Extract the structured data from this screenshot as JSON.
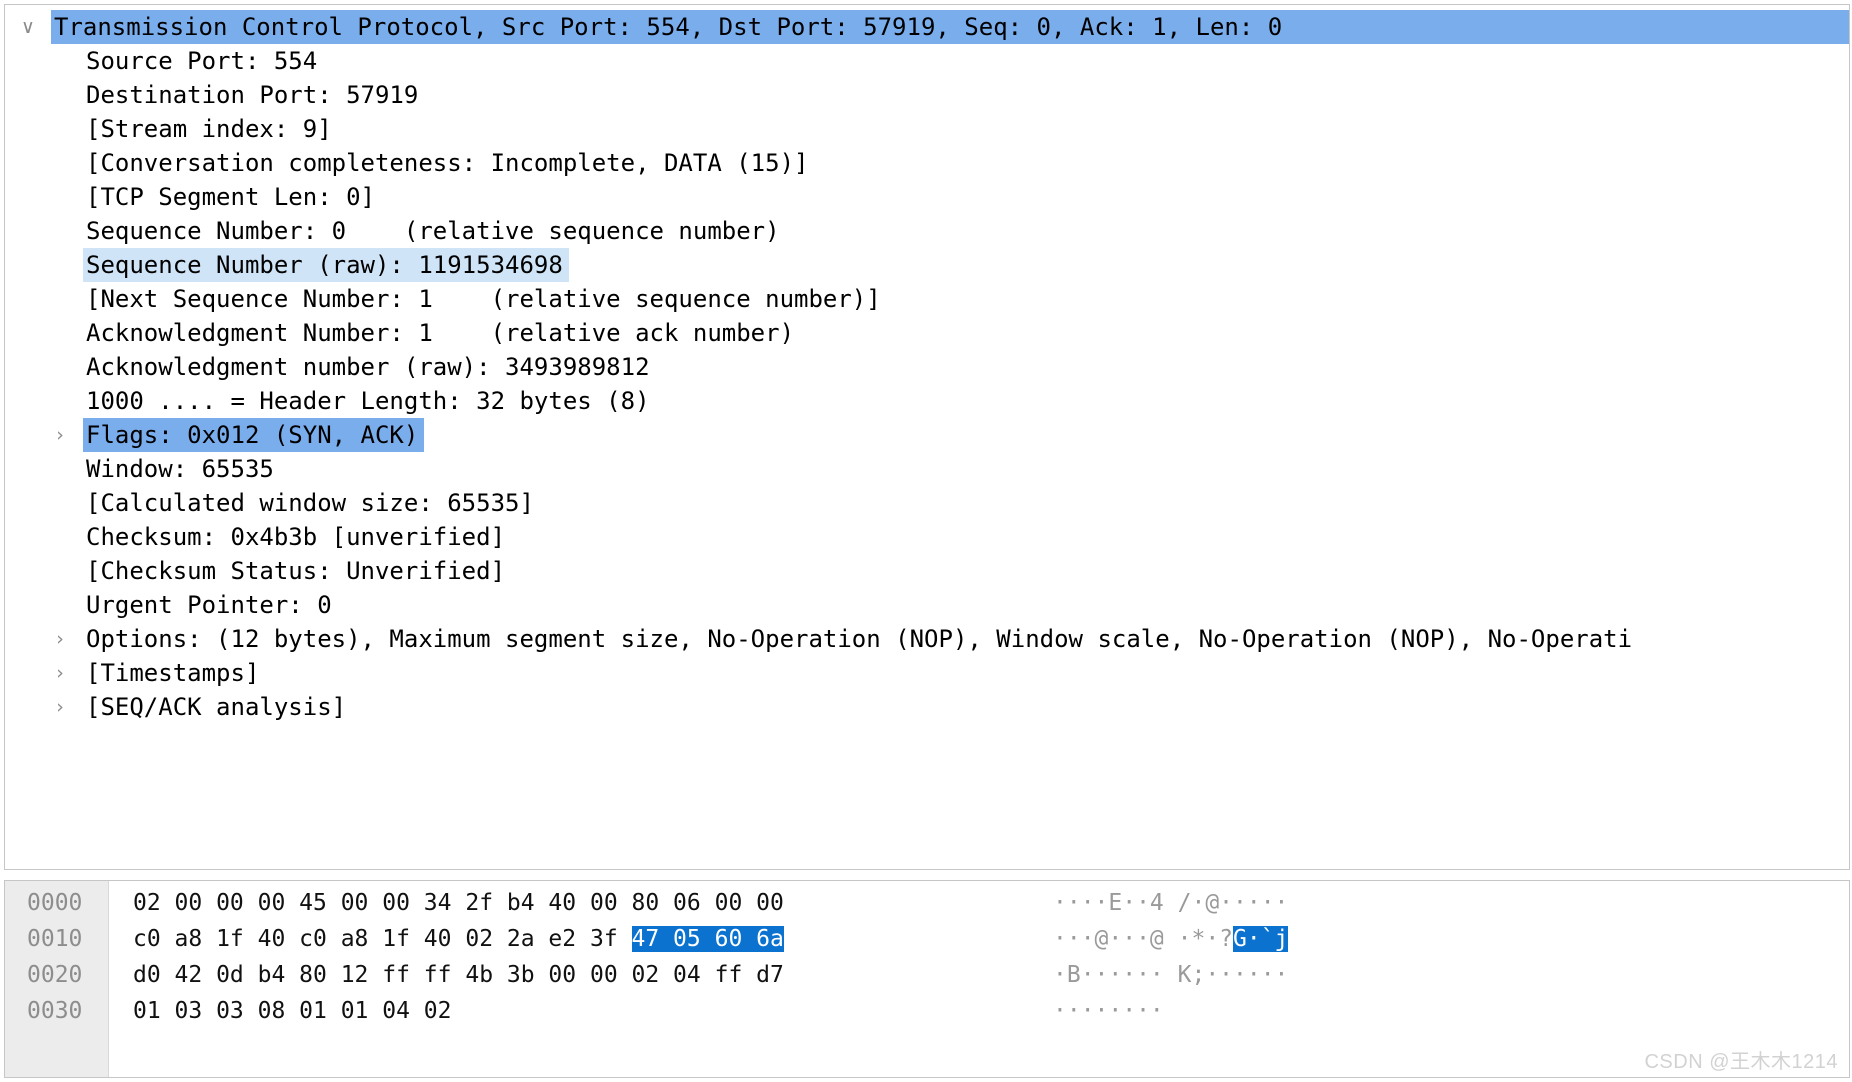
{
  "app": {
    "name": "Wireshark packet detail",
    "watermark": "CSDN @王木木1214"
  },
  "detail_pane": {
    "name": "packet-details",
    "rows": [
      {
        "text": "Transmission Control Protocol, Src Port: 554, Dst Port: 57919, Seq: 0, Ack: 1, Len: 0",
        "level": 0,
        "twisty": "∨",
        "state": "selected",
        "full_width": true
      },
      {
        "text": "Source Port: 554",
        "level": 1,
        "twisty": "",
        "state": "normal"
      },
      {
        "text": "Destination Port: 57919",
        "level": 1,
        "twisty": "",
        "state": "normal"
      },
      {
        "text": "[Stream index: 9]",
        "level": 1,
        "twisty": "",
        "state": "normal"
      },
      {
        "text": "[Conversation completeness: Incomplete, DATA (15)]",
        "level": 1,
        "twisty": "",
        "state": "normal"
      },
      {
        "text": "[TCP Segment Len: 0]",
        "level": 1,
        "twisty": "",
        "state": "normal"
      },
      {
        "text": "Sequence Number: 0    (relative sequence number)",
        "level": 1,
        "twisty": "",
        "state": "normal"
      },
      {
        "text": "Sequence Number (raw): 1191534698",
        "level": 1,
        "twisty": "",
        "state": "highlight"
      },
      {
        "text": "[Next Sequence Number: 1    (relative sequence number)]",
        "level": 1,
        "twisty": "",
        "state": "normal"
      },
      {
        "text": "Acknowledgment Number: 1    (relative ack number)",
        "level": 1,
        "twisty": "",
        "state": "normal"
      },
      {
        "text": "Acknowledgment number (raw): 3493989812",
        "level": 1,
        "twisty": "",
        "state": "normal"
      },
      {
        "text": "1000 .... = Header Length: 32 bytes (8)",
        "level": 1,
        "twisty": "",
        "state": "normal"
      },
      {
        "text": "Flags: 0x012 (SYN, ACK)",
        "level": 1,
        "twisty": "›",
        "state": "selected"
      },
      {
        "text": "Window: 65535",
        "level": 1,
        "twisty": "",
        "state": "normal"
      },
      {
        "text": "[Calculated window size: 65535]",
        "level": 1,
        "twisty": "",
        "state": "normal"
      },
      {
        "text": "Checksum: 0x4b3b [unverified]",
        "level": 1,
        "twisty": "",
        "state": "normal"
      },
      {
        "text": "[Checksum Status: Unverified]",
        "level": 1,
        "twisty": "",
        "state": "normal"
      },
      {
        "text": "Urgent Pointer: 0",
        "level": 1,
        "twisty": "",
        "state": "normal"
      },
      {
        "text": "Options: (12 bytes), Maximum segment size, No-Operation (NOP), Window scale, No-Operation (NOP), No-Operati",
        "level": 1,
        "twisty": "›",
        "state": "normal"
      },
      {
        "text": "[Timestamps]",
        "level": 1,
        "twisty": "›",
        "state": "normal"
      },
      {
        "text": "[SEQ/ACK analysis]",
        "level": 1,
        "twisty": "›",
        "state": "normal"
      }
    ]
  },
  "bytes_pane": {
    "name": "packet-bytes",
    "rows": [
      {
        "offset": "0000",
        "hex_groups": [
          {
            "text": "02 00 00 00 45 00 00 34 ",
            "highlight": false
          },
          {
            "text": "2f b4 40 00 80 06 00 00",
            "highlight": false
          }
        ],
        "ascii_groups": [
          {
            "text": "····E··4 ",
            "highlight": false,
            "dim": true
          },
          {
            "text": "/·@·····",
            "highlight": false,
            "dim": true
          }
        ]
      },
      {
        "offset": "0010",
        "hex_groups": [
          {
            "text": "c0 a8 1f 40 c0 a8 1f 40 ",
            "highlight": false
          },
          {
            "text": "02 2a e2 3f ",
            "highlight": false
          },
          {
            "text": "47 05 60 6a",
            "highlight": true
          }
        ],
        "ascii_groups": [
          {
            "text": "···@···@ ",
            "highlight": false,
            "dim": true
          },
          {
            "text": "·*·?",
            "highlight": false,
            "dim": true
          },
          {
            "text": "G·`j",
            "highlight": true,
            "dim": false
          }
        ]
      },
      {
        "offset": "0020",
        "hex_groups": [
          {
            "text": "d0 42 0d b4 80 12 ff ff ",
            "highlight": false
          },
          {
            "text": "4b 3b 00 00 02 04 ff d7",
            "highlight": false
          }
        ],
        "ascii_groups": [
          {
            "text": "·B······ ",
            "highlight": false,
            "dim": true
          },
          {
            "text": "K;······",
            "highlight": false,
            "dim": true
          }
        ]
      },
      {
        "offset": "0030",
        "hex_groups": [
          {
            "text": "01 03 03 08 01 01 04 02",
            "highlight": false
          }
        ],
        "ascii_groups": [
          {
            "text": "········",
            "highlight": false,
            "dim": true
          }
        ]
      }
    ]
  },
  "colors": {
    "selection_strong": "#7aadec",
    "selection_light": "#cfe4f7",
    "byte_highlight": "#0b72d0",
    "gutter_bg": "#ececed",
    "pane_border": "#c6c6c6"
  }
}
